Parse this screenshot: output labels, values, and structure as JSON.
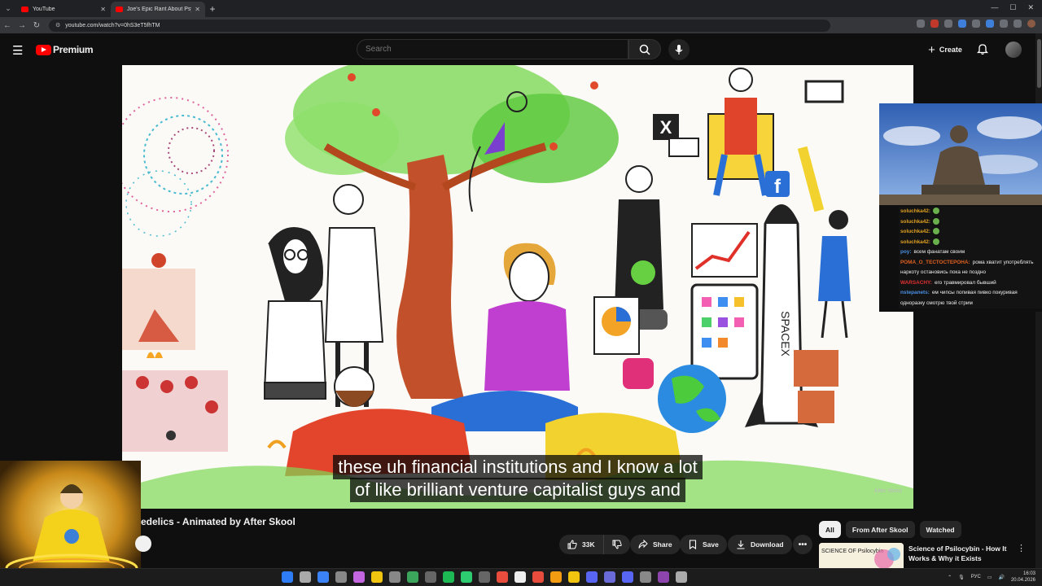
{
  "browser": {
    "tabs": [
      {
        "title": "YouTube",
        "active": false
      },
      {
        "title": "Joe's Epic Rant About Psyc",
        "active": true
      }
    ],
    "url": "youtube.com/watch?v=0hS3eT5fhTM"
  },
  "header": {
    "logo_text": "Premium",
    "search_placeholder": "Search",
    "create_label": "Create"
  },
  "player": {
    "caption_line1": "these uh financial institutions and I know a lot",
    "caption_line2": "of like brilliant venture capitalist guys and",
    "watermark": "After Skool",
    "art_labels": {
      "x_logo": "X",
      "fb_logo": "f",
      "rocket_text": "SPACEX"
    }
  },
  "video": {
    "title": "edelics - Animated by After Skool",
    "like_count": "33K",
    "share_label": "Share",
    "save_label": "Save",
    "download_label": "Download",
    "more_label": "•••"
  },
  "chips": [
    "All",
    "From After Skool",
    "Watched"
  ],
  "recommendation": {
    "title": "Science of Psilocybin - How It Works & Why it Exists",
    "thumb_text": "SCIENCE OF Psilocybin"
  },
  "chat": [
    {
      "user": "soluchka42:",
      "text": "",
      "color": "#e0a020",
      "smile": true
    },
    {
      "user": "soluchka42:",
      "text": "",
      "color": "#e0a020",
      "smile": true
    },
    {
      "user": "soluchka42:",
      "text": "",
      "color": "#e0a020",
      "smile": true
    },
    {
      "user": "soluchka42:",
      "text": "",
      "color": "#e0a020",
      "smile": true
    },
    {
      "user": "poy:",
      "text": "всем фанатам своим",
      "color": "#4a90e2",
      "smile": false
    },
    {
      "user": "РОМА_О_ТЕСТОСТЕРОНА:",
      "text": "рома хватит употреблять наркоту остановись пока не поздно",
      "color": "#e06020",
      "smile": false
    },
    {
      "user": "WARSACHY:",
      "text": "его травмировал бывший",
      "color": "#e03030",
      "smile": false
    },
    {
      "user": "nstepanets:",
      "text": "ем чипсы попивая пивко покуривая одноразку смотрю твой стрим",
      "color": "#4a90e2",
      "smile": false
    }
  ],
  "taskbar": {
    "lang": "РУС",
    "time": "16:03",
    "date": "20.04.2026"
  },
  "colors": {
    "accent": "#ff0000",
    "bg": "#0f0f0f",
    "chip_bg": "#272727"
  }
}
